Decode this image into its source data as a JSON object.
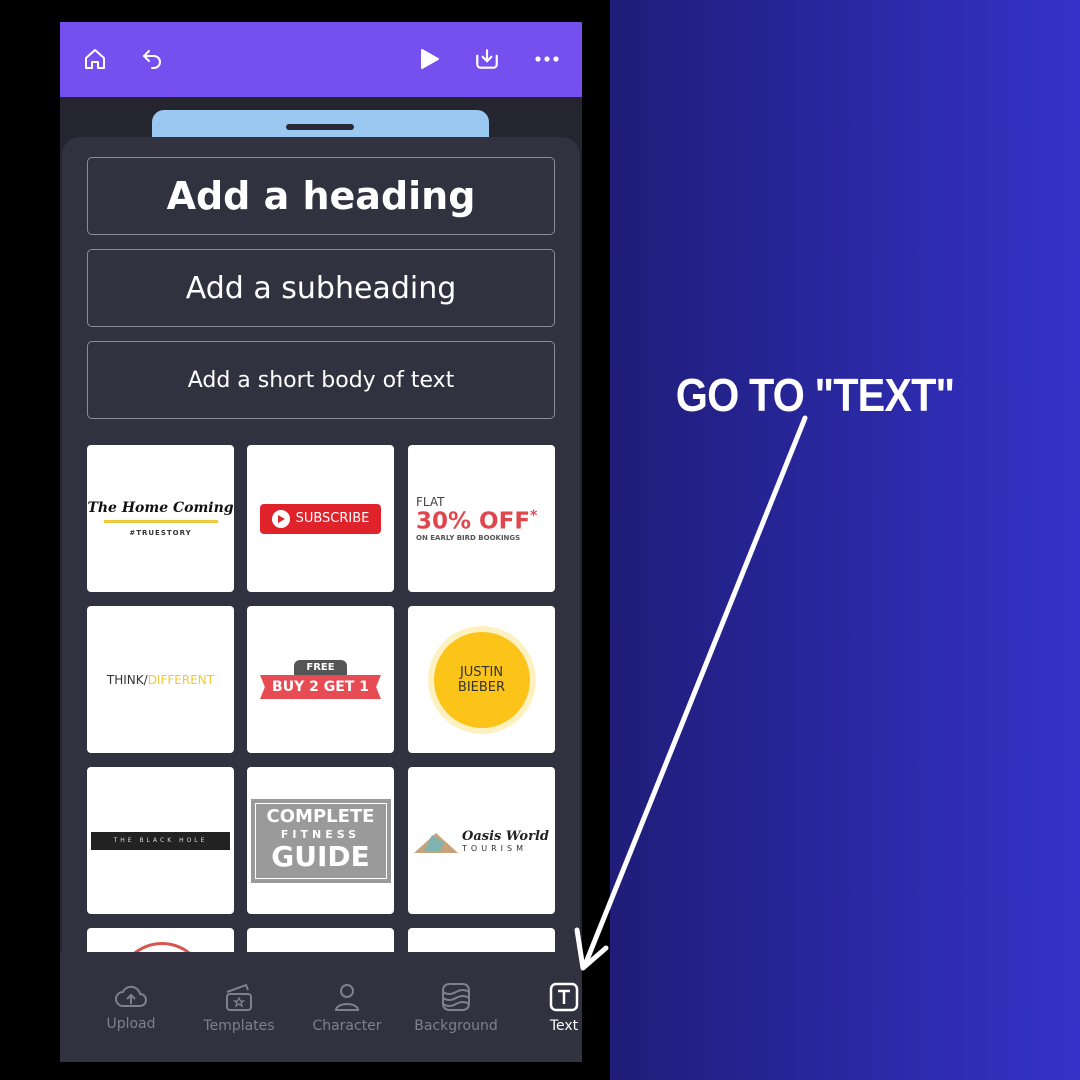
{
  "toolbar": {
    "icons": [
      "home-icon",
      "undo-icon",
      "play-icon",
      "download-icon",
      "more-icon"
    ],
    "color": "#7650ef"
  },
  "text_panel": {
    "heading": "Add a heading",
    "subheading": "Add a subheading",
    "body": "Add a short body of text"
  },
  "templates": [
    {
      "title": "The Home Coming",
      "sub": "#TRUESTORY"
    },
    {
      "title": "SUBSCRIBE"
    },
    {
      "pre": "FLAT",
      "title": "30% OFF",
      "star": "*",
      "sub": "ON EARLY BIRD BOOKINGS"
    },
    {
      "title": "THINK/",
      "title2": "DIFFERENT"
    },
    {
      "pre": "FREE",
      "title": "BUY 2 GET 1"
    },
    {
      "title": "JUSTIN",
      "title2": "BIEBER"
    },
    {
      "title": "THE BLACK HOLE"
    },
    {
      "title": "COMPLETE",
      "mid": "FITNESS",
      "title2": "GUIDE"
    },
    {
      "title": "Oasis World",
      "sub": "TOURISM"
    }
  ],
  "nav": [
    {
      "label": "Upload",
      "icon": "upload-cloud-icon"
    },
    {
      "label": "Templates",
      "icon": "templates-clapper-icon"
    },
    {
      "label": "Character",
      "icon": "person-icon"
    },
    {
      "label": "Background",
      "icon": "background-waves-icon"
    },
    {
      "label": "Text",
      "icon": "text-icon",
      "active": true
    }
  ],
  "callout": {
    "text": "GO TO \"TEXT\""
  }
}
